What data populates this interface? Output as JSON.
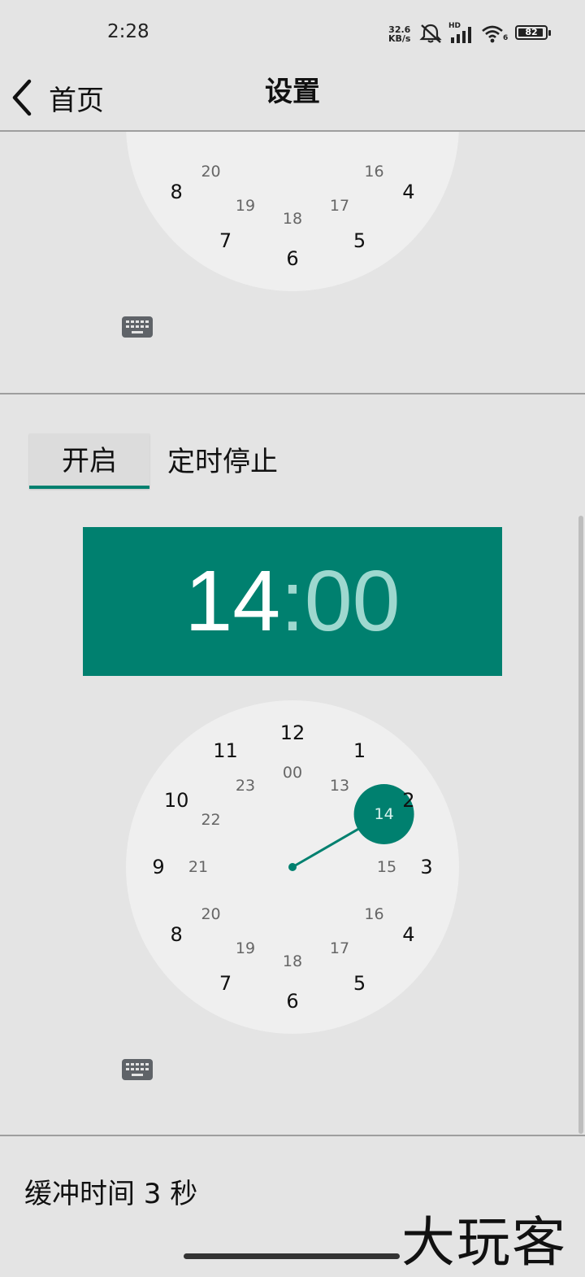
{
  "status_bar": {
    "time": "2:28",
    "net_speed_value": "32.6",
    "net_speed_unit": "KB/s",
    "hd_label": "HD",
    "wifi_badge": "6",
    "battery_level": "82"
  },
  "app_bar": {
    "back_label": "首页",
    "title": "设置"
  },
  "clock_face": {
    "outer": [
      "12",
      "1",
      "2",
      "3",
      "4",
      "5",
      "6",
      "7",
      "8",
      "9",
      "10",
      "11"
    ],
    "inner": [
      "00",
      "13",
      "14",
      "15",
      "16",
      "17",
      "18",
      "19",
      "20",
      "21",
      "22",
      "23"
    ],
    "selected_value": "14",
    "accent_color": "#00806f"
  },
  "schedule": {
    "toggle_label": "开启",
    "title": "定时停止",
    "hour": "14",
    "separator": ":",
    "minute": "00"
  },
  "buffer_label": "缓冲时间 3 秒",
  "watermark": "大玩客"
}
